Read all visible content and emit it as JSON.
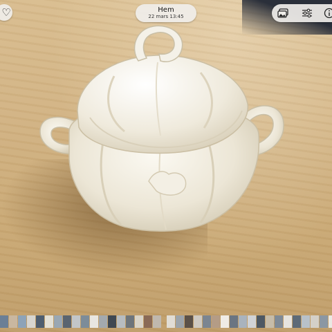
{
  "header": {
    "album_title": "Hem",
    "date_time": "22 mars  13:45"
  },
  "icons": {
    "favorite": "heart-icon",
    "photos": "photo-stack-icon",
    "adjust": "sliders-icon",
    "info": "info-icon"
  },
  "colors": {
    "pill_background": "#f0eeea",
    "table": "#d2b383",
    "porcelain": "#f1ede1"
  },
  "thumbnails": [
    "#6b7f96",
    "#c9b7a0",
    "#8da3b8",
    "#d7d5cf",
    "#4e5d6e",
    "#e3e0d6",
    "#9aa7b3",
    "#5a6470",
    "#c2c6c9",
    "#7d8c99",
    "#e8e6e1",
    "#a3a9ae",
    "#3f4852",
    "#b7bcc0",
    "#6e757b",
    "#d9d4c8",
    "#8a6a56",
    "#c0b8ae",
    "#e1ddd5",
    "#9da4aa",
    "#5b5148",
    "#cfcac2",
    "#7b8591",
    "#b49c86",
    "#efece6",
    "#6a7582",
    "#a9b3bd",
    "#d0d3d6",
    "#4d5863",
    "#c6bca9",
    "#7f8a96",
    "#e6e4df",
    "#5d6a77",
    "#b8c1c9",
    "#d4d0c8",
    "#8b97a3",
    "#eae8e3",
    "#6c7884",
    "#c3cbd2",
    "#9aa6b1",
    "#dedbd4",
    "#7a8692",
    "#b0bac3",
    "#e9e7e2",
    "#566370",
    "#c8c3b8",
    "#a7b0b8",
    "#d6dde2"
  ]
}
